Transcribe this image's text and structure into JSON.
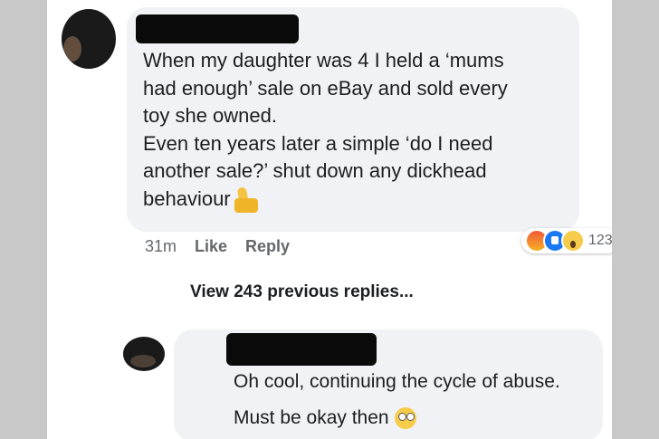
{
  "comment": {
    "text": "When my daughter was 4 I held a ‘mums\nhad enough’ sale on eBay and sold every\ntoy she owned.\nEven ten years later a simple ‘do I need\nanother sale?’ shut down any dickhead\nbehaviour",
    "time": "31m",
    "like_label": "Like",
    "reply_label": "Reply",
    "reaction_count": "123",
    "reaction_icons": [
      "angry-icon",
      "like-icon",
      "wow-icon"
    ],
    "trailing_emoji": "thumbs-up-icon"
  },
  "view_replies": "View 243 previous replies...",
  "reply": {
    "text": "Oh cool, continuing the cycle of abuse.\nMust be okay then",
    "trailing_emoji": "eye-roll-icon"
  },
  "colors": {
    "bubble": "#f0f2f5",
    "text": "#1c1e21",
    "meta": "#65676b",
    "like_blue": "#1877f2"
  }
}
